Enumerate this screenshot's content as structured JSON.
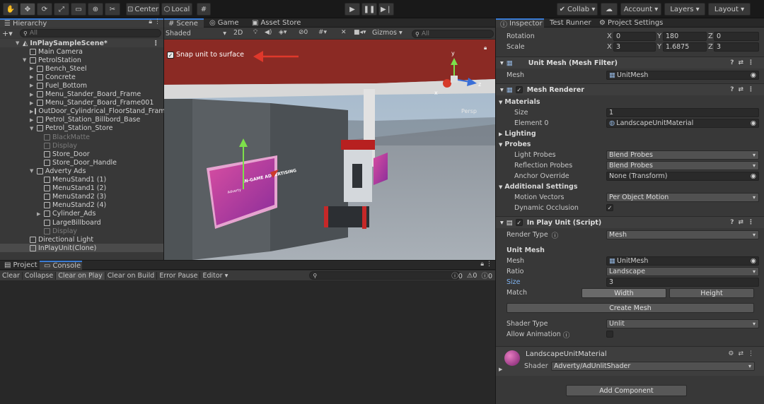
{
  "toolbar": {
    "pivot_label": "Center",
    "space_label": "Local",
    "collab_label": "Collab",
    "account_label": "Account",
    "layers_label": "Layers",
    "layout_label": "Layout"
  },
  "hierarchy": {
    "tab_label": "Hierarchy",
    "search_placeholder": "All",
    "scene_name": "InPlaySampleScene*",
    "items": [
      {
        "label": "Main Camera",
        "depth": 1,
        "arrow": false,
        "dim": false
      },
      {
        "label": "PetrolStation",
        "depth": 1,
        "arrow": true,
        "expanded": true,
        "dim": false
      },
      {
        "label": "Bench_Steel",
        "depth": 2,
        "arrow": true,
        "dim": false
      },
      {
        "label": "Concrete",
        "depth": 2,
        "arrow": true,
        "dim": false
      },
      {
        "label": "Fuel_Bottom",
        "depth": 2,
        "arrow": true,
        "dim": false
      },
      {
        "label": "Menu_Stander_Board_Frame",
        "depth": 2,
        "arrow": true,
        "dim": false
      },
      {
        "label": "Menu_Stander_Board_Frame001",
        "depth": 2,
        "arrow": true,
        "dim": false
      },
      {
        "label": "OutDoor_Cylindrical_FloorStand_Frame",
        "depth": 2,
        "arrow": true,
        "dim": false
      },
      {
        "label": "Petrol_Station_Billbord_Base",
        "depth": 2,
        "arrow": true,
        "dim": false
      },
      {
        "label": "Petrol_Station_Store",
        "depth": 2,
        "arrow": true,
        "expanded": true,
        "dim": false
      },
      {
        "label": "BlackMatte",
        "depth": 3,
        "arrow": false,
        "dim": true
      },
      {
        "label": "Display",
        "depth": 3,
        "arrow": false,
        "dim": true
      },
      {
        "label": "Store_Door",
        "depth": 3,
        "arrow": false,
        "dim": false
      },
      {
        "label": "Store_Door_Handle",
        "depth": 3,
        "arrow": false,
        "dim": false
      },
      {
        "label": "Adverty Ads",
        "depth": 2,
        "arrow": true,
        "expanded": true,
        "dim": false
      },
      {
        "label": "MenuStand1 (1)",
        "depth": 3,
        "arrow": false,
        "dim": false
      },
      {
        "label": "MenuStand1 (2)",
        "depth": 3,
        "arrow": false,
        "dim": false
      },
      {
        "label": "MenuStand2 (3)",
        "depth": 3,
        "arrow": false,
        "dim": false
      },
      {
        "label": "MenuStand2 (4)",
        "depth": 3,
        "arrow": false,
        "dim": false
      },
      {
        "label": "Cylinder_Ads",
        "depth": 3,
        "arrow": true,
        "dim": false
      },
      {
        "label": "LargeBillboard",
        "depth": 3,
        "arrow": false,
        "dim": false
      },
      {
        "label": "Display",
        "depth": 3,
        "arrow": false,
        "dim": true
      },
      {
        "label": "Directional Light",
        "depth": 1,
        "arrow": false,
        "dim": false
      },
      {
        "label": "InPlayUnit(Clone)",
        "depth": 1,
        "arrow": false,
        "dim": false,
        "selected": true
      }
    ]
  },
  "scene": {
    "tabs": [
      "Scene",
      "Game",
      "Asset Store"
    ],
    "shading": "Shaded",
    "mode_2d": "2D",
    "hidden_count": "0",
    "gizmos_label": "Gizmos",
    "search_placeholder": "All",
    "snap_label": "Snap unit to surface",
    "persp_label": "Persp",
    "axis_x": "x",
    "axis_y": "y",
    "axis_z": "z",
    "billboard_text": "IN-GAME ADVERTISING",
    "billboard_brand": "Adverty"
  },
  "console": {
    "tabs": [
      "Project",
      "Console"
    ],
    "buttons": [
      "Clear",
      "Collapse",
      "Clear on Play",
      "Clear on Build",
      "Error Pause",
      "Editor"
    ],
    "log_count": "0",
    "warn_count": "0",
    "error_count": "0"
  },
  "inspector": {
    "tabs": [
      "Inspector",
      "Test Runner",
      "Project Settings"
    ],
    "rotation": {
      "label": "Rotation",
      "x": "0",
      "y": "180",
      "z": "0"
    },
    "scale": {
      "label": "Scale",
      "x": "3",
      "y": "1.6875",
      "z": "3"
    },
    "xyz": [
      "X",
      "Y",
      "Z"
    ],
    "mesh_filter": {
      "title": "Unit Mesh (Mesh Filter)",
      "mesh_label": "Mesh",
      "mesh_value": "UnitMesh"
    },
    "mesh_renderer": {
      "title": "Mesh Renderer",
      "materials_label": "Materials",
      "size_label": "Size",
      "size_value": "1",
      "element0_label": "Element 0",
      "element0_value": "LandscapeUnitMaterial",
      "lighting_label": "Lighting",
      "probes_label": "Probes",
      "light_probes_label": "Light Probes",
      "light_probes_value": "Blend Probes",
      "reflection_probes_label": "Reflection Probes",
      "reflection_probes_value": "Blend Probes",
      "anchor_override_label": "Anchor Override",
      "anchor_override_value": "None (Transform)",
      "additional_label": "Additional Settings",
      "motion_vectors_label": "Motion Vectors",
      "motion_vectors_value": "Per Object Motion",
      "dynamic_occlusion_label": "Dynamic Occlusion"
    },
    "inplay": {
      "title": "In Play Unit (Script)",
      "render_type_label": "Render Type",
      "render_type_value": "Mesh",
      "unit_mesh_label": "Unit Mesh",
      "mesh_label": "Mesh",
      "mesh_value": "UnitMesh",
      "ratio_label": "Ratio",
      "ratio_value": "Landscape",
      "size_label": "Size",
      "size_value": "3",
      "match_label": "Match",
      "width_label": "Width",
      "height_label": "Height",
      "create_mesh_label": "Create Mesh",
      "shader_type_label": "Shader Type",
      "shader_type_value": "Unlit",
      "allow_animation_label": "Allow Animation"
    },
    "material": {
      "name": "LandscapeUnitMaterial",
      "shader_label": "Shader",
      "shader_value": "Adverty/AdUnlitShader"
    },
    "add_component_label": "Add Component"
  },
  "colors": {
    "accent": "#3a7cd6",
    "selection": "#2c5d87",
    "panel": "#383838",
    "arrow_red": "#e0382b",
    "billboard_magenta": "#b72c8c"
  }
}
